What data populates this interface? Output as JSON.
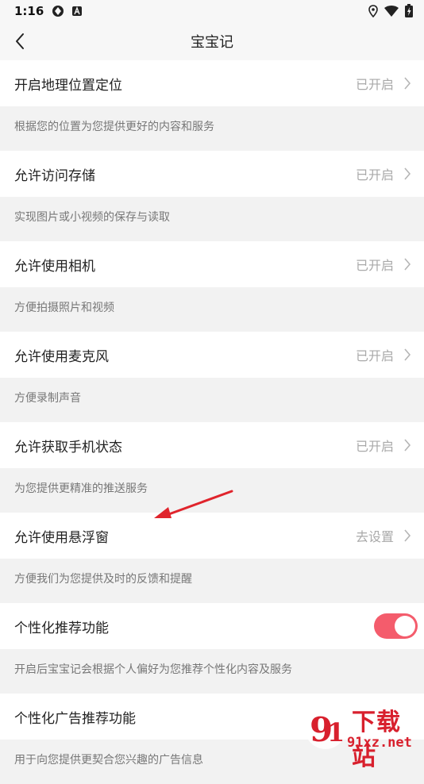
{
  "status_bar": {
    "time": "1:16"
  },
  "header": {
    "title": "宝宝记"
  },
  "permissions": [
    {
      "label": "开启地理位置定位",
      "status": "已开启",
      "description": "根据您的位置为您提供更好的内容和服务"
    },
    {
      "label": "允许访问存储",
      "status": "已开启",
      "description": "实现图片或小视频的保存与读取"
    },
    {
      "label": "允许使用相机",
      "status": "已开启",
      "description": "方便拍摄照片和视频"
    },
    {
      "label": "允许使用麦克风",
      "status": "已开启",
      "description": "方便录制声音"
    },
    {
      "label": "允许获取手机状态",
      "status": "已开启",
      "description": "为您提供更精准的推送服务"
    },
    {
      "label": "允许使用悬浮窗",
      "status": "去设置",
      "description": "方便我们为您提供及时的反馈和提醒"
    }
  ],
  "personalization": {
    "label": "个性化推荐功能",
    "enabled": true,
    "description": "开启后宝宝记会根据个人偏好为您推荐个性化内容及服务"
  },
  "ad_personalization": {
    "label": "个性化广告推荐功能",
    "description": "用于向您提供更契合您兴趣的广告信息"
  },
  "watermark": {
    "title": "下载站",
    "url": "91xz.net",
    "logo_text": "91"
  },
  "colors": {
    "accent": "#f45c6c",
    "arrow": "#e0242c",
    "watermark": "#d8202d"
  }
}
